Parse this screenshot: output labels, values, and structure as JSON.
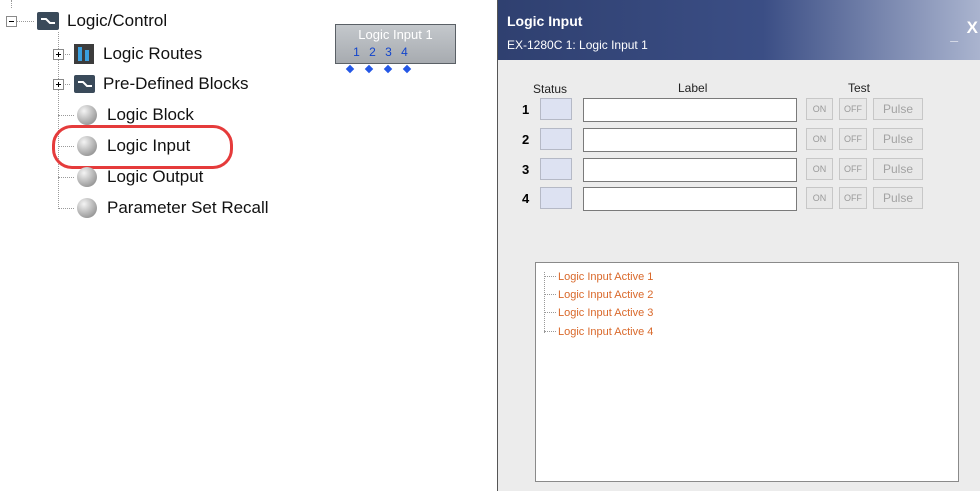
{
  "tree": {
    "root_label": "Logic/Control",
    "items": [
      {
        "label": "Logic Routes"
      },
      {
        "label": "Pre-Defined Blocks"
      },
      {
        "label": "Logic Block"
      },
      {
        "label": "Logic Input"
      },
      {
        "label": "Logic Output"
      },
      {
        "label": "Parameter Set Recall"
      }
    ]
  },
  "block": {
    "title": "Logic Input 1",
    "pins": [
      "1",
      "2",
      "3",
      "4"
    ]
  },
  "dialog": {
    "title": "Logic Input",
    "subtitle": "EX-1280C 1: Logic Input 1",
    "min_label": "_",
    "close_label": "X",
    "headers": {
      "status": "Status",
      "label": "Label",
      "test": "Test"
    },
    "rows": [
      {
        "num": "1",
        "label_value": "",
        "on": "ON",
        "off": "OFF",
        "pulse": "Pulse"
      },
      {
        "num": "2",
        "label_value": "",
        "on": "ON",
        "off": "OFF",
        "pulse": "Pulse"
      },
      {
        "num": "3",
        "label_value": "",
        "on": "ON",
        "off": "OFF",
        "pulse": "Pulse"
      },
      {
        "num": "4",
        "label_value": "",
        "on": "ON",
        "off": "OFF",
        "pulse": "Pulse"
      }
    ],
    "list_items": [
      "Logic Input Active 1",
      "Logic Input Active 2",
      "Logic Input Active 3",
      "Logic Input Active 4"
    ]
  },
  "colors": {
    "highlight": "#e53b3b",
    "titlebar": "#2f4070",
    "list_text": "#d9682a",
    "pin": "#2457e6"
  }
}
